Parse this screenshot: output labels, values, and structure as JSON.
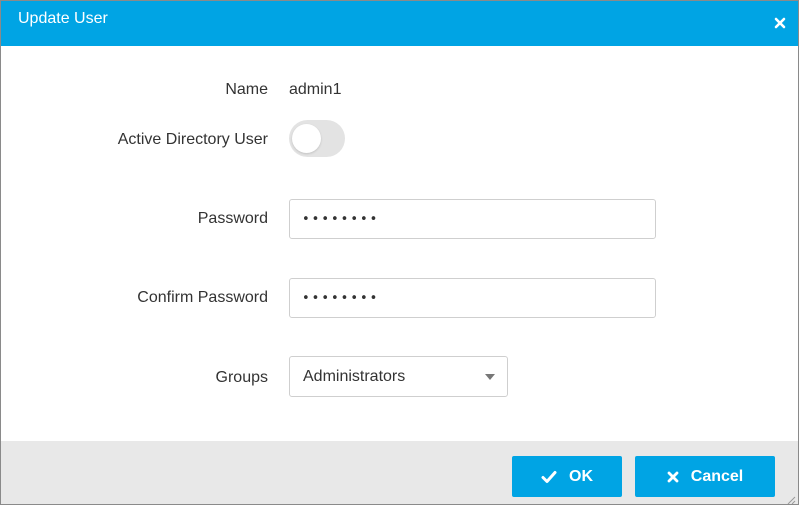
{
  "dialog": {
    "title": "Update User",
    "close_icon": "close-icon"
  },
  "form": {
    "name_label": "Name",
    "name_value": "admin1",
    "ad_user_label": "Active Directory User",
    "ad_user_enabled": false,
    "password_label": "Password",
    "password_value": "••••••••",
    "confirm_label": "Confirm Password",
    "confirm_value": "••••••••",
    "groups_label": "Groups",
    "groups_selected": "Administrators"
  },
  "footer": {
    "ok_label": "OK",
    "ok_icon": "check-icon",
    "cancel_label": "Cancel",
    "cancel_icon": "times-icon"
  },
  "colors": {
    "accent": "#00a4e4",
    "footer_bg": "#e8e8e8",
    "toggle_off": "#e3e3e3"
  }
}
